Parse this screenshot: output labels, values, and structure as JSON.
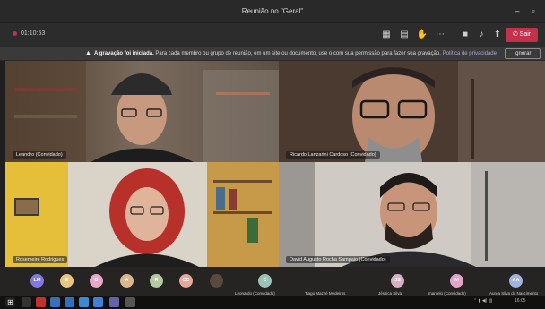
{
  "window": {
    "title": "Reunião no \"Geral\""
  },
  "toolbar": {
    "timer": "01:10:53",
    "leave_label": "Sair"
  },
  "banner": {
    "bold": "A gravação foi iniciada.",
    "message": "Para cada membro ou grupo de reunião, em um site ou documento, use o com sua permissão para fazer sua gravação.",
    "link": "Política de privacidade",
    "dismiss_label": "Ignorar"
  },
  "tiles": [
    {
      "name": "Leandro (Convidado)"
    },
    {
      "name": "Ricardo Lanzarini Cardoso (Convidado)"
    },
    {
      "name": "Rosemeire Rodrigues"
    },
    {
      "name": "David Augusto Rocha Sampaio (Convidado)"
    }
  ],
  "participants": [
    {
      "initials": "LM",
      "color": "#8378de"
    },
    {
      "initials": "E",
      "color": "#e8c785"
    },
    {
      "initials": "D",
      "color": "#e8a8c8"
    },
    {
      "initials": "A",
      "color": "#dbb78e"
    },
    {
      "initials": "R",
      "color": "#b7c9a0"
    },
    {
      "initials": "CC",
      "color": "#e8a89a"
    },
    {
      "initials": "C",
      "color": "#9bc3b8",
      "label": "Leonardo (Convidado)"
    },
    {
      "initials": "",
      "color": "#3d5a7a",
      "label": "Tiago Mazzé Medeiros"
    },
    {
      "initials": "JS",
      "color": "#d9b0c3",
      "label": "Jéssica Silva"
    },
    {
      "initials": "M",
      "color": "#e5a3c7",
      "label": "marcelo (Convidado)"
    },
    {
      "initials": "AA",
      "color": "#9fb5e0",
      "label": "Aurea Silva do Nascimento"
    }
  ],
  "taskbar": {
    "clock": "16:05"
  }
}
